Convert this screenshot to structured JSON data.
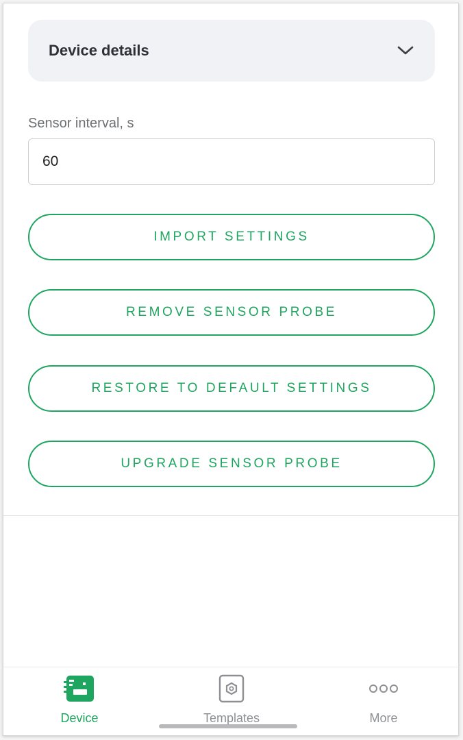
{
  "accordion": {
    "title": "Device details"
  },
  "sensor_interval": {
    "label": "Sensor interval, s",
    "value": "60"
  },
  "actions": {
    "import": "IMPORT SETTINGS",
    "remove": "REMOVE SENSOR PROBE",
    "restore": "RESTORE TO DEFAULT SETTINGS",
    "upgrade": "UPGRADE SENSOR PROBE"
  },
  "nav": {
    "device": "Device",
    "templates": "Templates",
    "more": "More"
  },
  "colors": {
    "accent": "#1ea55f",
    "inactive": "#8d8f93",
    "accordion_bg": "#f1f2f6"
  }
}
